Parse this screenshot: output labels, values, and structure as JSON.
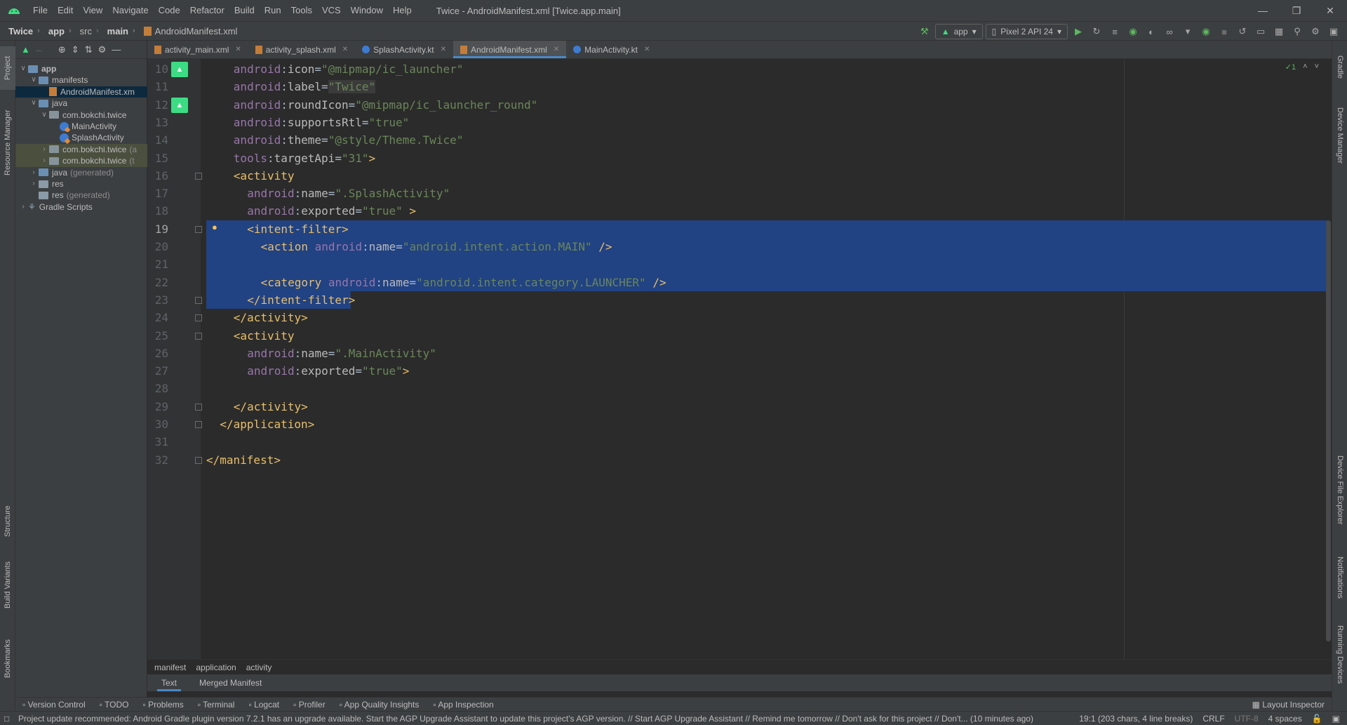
{
  "titlebar": {
    "menu": [
      "File",
      "Edit",
      "View",
      "Navigate",
      "Code",
      "Refactor",
      "Build",
      "Run",
      "Tools",
      "VCS",
      "Window",
      "Help"
    ],
    "window_title": "Twice - AndroidManifest.xml [Twice.app.main]"
  },
  "navbar": {
    "crumbs": [
      "Twice",
      "app",
      "src",
      "main",
      "AndroidManifest.xml"
    ],
    "run_config": "app",
    "device": "Pixel 2 API 24"
  },
  "leftstrip": {
    "tabs": [
      "Project",
      "Resource Manager",
      "Structure",
      "Build Variants",
      "Bookmarks"
    ]
  },
  "rightstrip": {
    "tabs": [
      "Gradle",
      "Device Manager",
      "Device File Explorer",
      "Notifications",
      "Running Devices"
    ]
  },
  "project_tree": [
    {
      "label": "app",
      "suffix": "",
      "indent": 0,
      "arrow": "open",
      "icon": "folder-blue",
      "bold": true
    },
    {
      "label": "manifests",
      "suffix": "",
      "indent": 1,
      "arrow": "open",
      "icon": "folder-blue"
    },
    {
      "label": "AndroidManifest.xm",
      "suffix": "",
      "indent": 2,
      "arrow": "",
      "icon": "xml",
      "selected": true
    },
    {
      "label": "java",
      "suffix": "",
      "indent": 1,
      "arrow": "open",
      "icon": "folder-blue"
    },
    {
      "label": "com.bokchi.twice",
      "suffix": "",
      "indent": 2,
      "arrow": "open",
      "icon": "folder"
    },
    {
      "label": "MainActivity",
      "suffix": "",
      "indent": 3,
      "arrow": "",
      "icon": "kt"
    },
    {
      "label": "SplashActivity",
      "suffix": "",
      "indent": 3,
      "arrow": "",
      "icon": "kt"
    },
    {
      "label": "com.bokchi.twice",
      "suffix": "(a",
      "indent": 2,
      "arrow": "closed",
      "icon": "folder",
      "hl": true
    },
    {
      "label": "com.bokchi.twice",
      "suffix": "(t",
      "indent": 2,
      "arrow": "closed",
      "icon": "folder",
      "hl": true
    },
    {
      "label": "java",
      "suffix": "(generated)",
      "indent": 1,
      "arrow": "closed",
      "icon": "folder-blue"
    },
    {
      "label": "res",
      "suffix": "",
      "indent": 1,
      "arrow": "closed",
      "icon": "folder-res"
    },
    {
      "label": "res",
      "suffix": "(generated)",
      "indent": 1,
      "arrow": "",
      "icon": "folder-res"
    },
    {
      "label": "Gradle Scripts",
      "suffix": "",
      "indent": 0,
      "arrow": "closed",
      "icon": "gradle"
    }
  ],
  "tabs": [
    {
      "label": "activity_main.xml",
      "icon": "xml",
      "active": false
    },
    {
      "label": "activity_splash.xml",
      "icon": "xml",
      "active": false
    },
    {
      "label": "SplashActivity.kt",
      "icon": "kt",
      "active": false
    },
    {
      "label": "AndroidManifest.xml",
      "icon": "xml",
      "active": true
    },
    {
      "label": "MainActivity.kt",
      "icon": "kt",
      "active": false
    }
  ],
  "inspection_count": "1",
  "code_lines": [
    {
      "n": "10",
      "indent": 4,
      "parts": [
        [
          "attr-ns",
          "android"
        ],
        [
          "t",
          ":"
        ],
        [
          "attr",
          "icon"
        ],
        [
          "t",
          "="
        ],
        [
          "str",
          "\"@mipmap/ic_launcher\""
        ]
      ]
    },
    {
      "n": "11",
      "indent": 4,
      "parts": [
        [
          "attr-ns",
          "android"
        ],
        [
          "t",
          ":"
        ],
        [
          "attr",
          "label"
        ],
        [
          "t",
          "="
        ],
        [
          "str",
          "\"Twice\""
        ]
      ]
    },
    {
      "n": "12",
      "indent": 4,
      "parts": [
        [
          "attr-ns",
          "android"
        ],
        [
          "t",
          ":"
        ],
        [
          "attr",
          "roundIcon"
        ],
        [
          "t",
          "="
        ],
        [
          "str",
          "\"@mipmap/ic_launcher_round\""
        ]
      ]
    },
    {
      "n": "13",
      "indent": 4,
      "parts": [
        [
          "attr-ns",
          "android"
        ],
        [
          "t",
          ":"
        ],
        [
          "attr",
          "supportsRtl"
        ],
        [
          "t",
          "="
        ],
        [
          "str",
          "\"true\""
        ]
      ]
    },
    {
      "n": "14",
      "indent": 4,
      "parts": [
        [
          "attr-ns",
          "android"
        ],
        [
          "t",
          ":"
        ],
        [
          "attr",
          "theme"
        ],
        [
          "t",
          "="
        ],
        [
          "str",
          "\"@style/Theme.Twice\""
        ]
      ]
    },
    {
      "n": "15",
      "indent": 4,
      "parts": [
        [
          "attr-ns",
          "tools"
        ],
        [
          "t",
          ":"
        ],
        [
          "attr",
          "targetApi"
        ],
        [
          "t",
          "="
        ],
        [
          "str",
          "\"31\""
        ],
        [
          "tag",
          ">"
        ]
      ]
    },
    {
      "n": "16",
      "indent": 4,
      "parts": [
        [
          "tag",
          "<activity"
        ]
      ]
    },
    {
      "n": "17",
      "indent": 6,
      "parts": [
        [
          "attr-ns",
          "android"
        ],
        [
          "t",
          ":"
        ],
        [
          "attr",
          "name"
        ],
        [
          "t",
          "="
        ],
        [
          "str",
          "\".SplashActivity\""
        ]
      ]
    },
    {
      "n": "18",
      "indent": 6,
      "parts": [
        [
          "attr-ns",
          "android"
        ],
        [
          "t",
          ":"
        ],
        [
          "attr",
          "exported"
        ],
        [
          "t",
          "="
        ],
        [
          "str",
          "\"true\""
        ],
        [
          "tag",
          " >"
        ]
      ]
    },
    {
      "n": "19",
      "indent": 6,
      "parts": [
        [
          "tag",
          "<intent-filter>"
        ]
      ]
    },
    {
      "n": "20",
      "indent": 8,
      "parts": [
        [
          "tag",
          "<action "
        ],
        [
          "attr-ns",
          "android"
        ],
        [
          "t",
          ":"
        ],
        [
          "attr",
          "name"
        ],
        [
          "t",
          "="
        ],
        [
          "str",
          "\"android.intent.action.MAIN\""
        ],
        [
          "tag",
          " />"
        ]
      ]
    },
    {
      "n": "21",
      "indent": 0,
      "parts": []
    },
    {
      "n": "22",
      "indent": 8,
      "parts": [
        [
          "tag",
          "<category "
        ],
        [
          "attr-ns",
          "android"
        ],
        [
          "t",
          ":"
        ],
        [
          "attr",
          "name"
        ],
        [
          "t",
          "="
        ],
        [
          "str",
          "\"android.intent.category.LAUNCHER\""
        ],
        [
          "tag",
          " />"
        ]
      ]
    },
    {
      "n": "23",
      "indent": 6,
      "parts": [
        [
          "tag",
          "</intent-filter>"
        ]
      ]
    },
    {
      "n": "24",
      "indent": 4,
      "parts": [
        [
          "tag",
          "</activity>"
        ]
      ]
    },
    {
      "n": "25",
      "indent": 4,
      "parts": [
        [
          "tag",
          "<activity"
        ]
      ]
    },
    {
      "n": "26",
      "indent": 6,
      "parts": [
        [
          "attr-ns",
          "android"
        ],
        [
          "t",
          ":"
        ],
        [
          "attr",
          "name"
        ],
        [
          "t",
          "="
        ],
        [
          "str",
          "\".MainActivity\""
        ]
      ]
    },
    {
      "n": "27",
      "indent": 6,
      "parts": [
        [
          "attr-ns",
          "android"
        ],
        [
          "t",
          ":"
        ],
        [
          "attr",
          "exported"
        ],
        [
          "t",
          "="
        ],
        [
          "str",
          "\"true\""
        ],
        [
          "tag",
          ">"
        ]
      ]
    },
    {
      "n": "28",
      "indent": 0,
      "parts": []
    },
    {
      "n": "29",
      "indent": 4,
      "parts": [
        [
          "tag",
          "</activity>"
        ]
      ]
    },
    {
      "n": "30",
      "indent": 2,
      "parts": [
        [
          "tag",
          "</application>"
        ]
      ]
    },
    {
      "n": "31",
      "indent": 0,
      "parts": []
    },
    {
      "n": "32",
      "indent": 0,
      "parts": [
        [
          "tag",
          "</manifest>"
        ]
      ]
    }
  ],
  "editor_breadcrumb": [
    "manifest",
    "application",
    "activity"
  ],
  "subtabs": [
    {
      "label": "Text",
      "active": true
    },
    {
      "label": "Merged Manifest",
      "active": false
    }
  ],
  "bottom_tools": [
    "Version Control",
    "TODO",
    "Problems",
    "Terminal",
    "Logcat",
    "Profiler",
    "App Quality Insights",
    "App Inspection"
  ],
  "layout_inspector": "Layout Inspector",
  "status": {
    "message": "Project update recommended: Android Gradle plugin version 7.2.1 has an upgrade available.  Start the AGP Upgrade Assistant to update this project's AGP version. // Start AGP Upgrade Assistant // Remind me tomorrow // Don't ask for this project // Don't... (10 minutes ago)",
    "position": "19:1 (203 chars, 4 line breaks)",
    "line_sep": "CRLF",
    "encoding": "UTF-8",
    "indent": "4 spaces"
  },
  "colors": {
    "selection": "#214283",
    "accent": "#4a88c7",
    "android_green": "#3ddc84"
  }
}
